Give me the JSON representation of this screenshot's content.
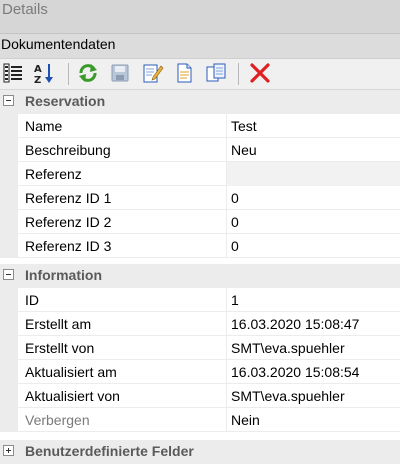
{
  "window": {
    "title": "Details"
  },
  "section": {
    "title": "Dokumentendaten"
  },
  "toolbar": {
    "buttons": [
      {
        "icon": "categorized-view-icon"
      },
      {
        "icon": "sort-alphabetical-icon"
      },
      {
        "icon": "refresh-icon"
      },
      {
        "icon": "save-icon"
      },
      {
        "icon": "edit-document-icon"
      },
      {
        "icon": "document-icon"
      },
      {
        "icon": "copy-document-icon"
      },
      {
        "icon": "delete-icon"
      }
    ]
  },
  "categories": [
    {
      "label": "Reservation",
      "expanded": true,
      "rows": [
        {
          "name": "Name",
          "value": "Test"
        },
        {
          "name": "Beschreibung",
          "value": "Neu"
        },
        {
          "name": "Referenz",
          "value": ""
        },
        {
          "name": "Referenz ID 1",
          "value": "0"
        },
        {
          "name": "Referenz ID 2",
          "value": "0"
        },
        {
          "name": "Referenz ID 3",
          "value": "0"
        }
      ]
    },
    {
      "label": "Information",
      "expanded": true,
      "rows": [
        {
          "name": "ID",
          "value": "1"
        },
        {
          "name": "Erstellt am",
          "value": "16.03.2020 15:08:47"
        },
        {
          "name": "Erstellt von",
          "value": "SMT\\eva.spuehler"
        },
        {
          "name": "Aktualisiert am",
          "value": "16.03.2020 15:08:54"
        },
        {
          "name": "Aktualisiert von",
          "value": "SMT\\eva.spuehler"
        },
        {
          "name": "Verbergen",
          "value": "Nein"
        }
      ]
    },
    {
      "label": "Benutzerdefinierte Felder",
      "expanded": false,
      "rows": []
    }
  ]
}
